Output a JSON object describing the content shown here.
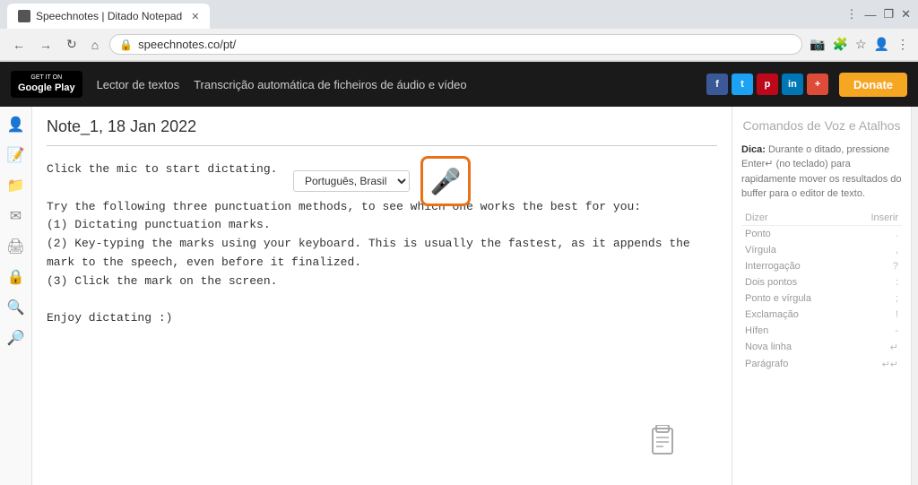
{
  "browser": {
    "tab_title": "Speechnotes | Ditado Notepad",
    "url": "speechnotes.co/pt/",
    "nav_back": "←",
    "nav_forward": "→",
    "nav_refresh": "↻",
    "nav_home": "⌂",
    "window_min": "—",
    "window_restore": "❐",
    "window_close": "✕"
  },
  "topnav": {
    "google_play_small": "GET IT ON",
    "google_play_big": "Google Play",
    "nav_link1": "Lector de textos",
    "nav_link2": "Transcrição automática de ficheiros de áudio e vídeo",
    "social_fb": "f",
    "social_tw": "t",
    "social_pin": "p",
    "social_lin": "in",
    "social_gp": "+",
    "donate_label": "Donate"
  },
  "sidebar": {
    "icons": [
      "👤",
      "📄",
      "📁",
      "✉",
      "🖨",
      "🔒",
      "🔍",
      "🔎"
    ]
  },
  "editor": {
    "note_title": "Note_1, 18 Jan 2022",
    "language_select": "Português, Brasil",
    "content": "Click the mic to start dictating.\n\nTry the following three punctuation methods, to see which one works the best for you:\n(1) Dictating punctuation marks.\n(2) Key-typing the marks using your keyboard. This is usually the fastest, as it appends the\nmark to the speech, even before it finalized.\n(3) Click the mark on the screen.\n\nEnjoy dictating :)"
  },
  "right_panel": {
    "title": "Comandos de Voz e Atalhos",
    "tip_label": "Dica:",
    "tip_text": " Durante o ditado, pressione Enter↵ (no teclado) para rapidamente mover os resultados do buffer para o editor de texto.",
    "table_headers": [
      "Dizer",
      "Inserir"
    ],
    "commands": [
      {
        "say": "Ponto",
        "insert": "."
      },
      {
        "say": "Vírgula",
        "insert": ","
      },
      {
        "say": "Interrogação",
        "insert": "?"
      },
      {
        "say": "Dois pontos",
        "insert": ":"
      },
      {
        "say": "Ponto e vírgula",
        "insert": ";"
      },
      {
        "say": "Exclamação",
        "insert": "!"
      },
      {
        "say": "Hífen",
        "insert": "-"
      },
      {
        "say": "Nova linha",
        "insert": "↵"
      },
      {
        "say": "Parágrafo",
        "insert": "↵↵"
      }
    ]
  }
}
